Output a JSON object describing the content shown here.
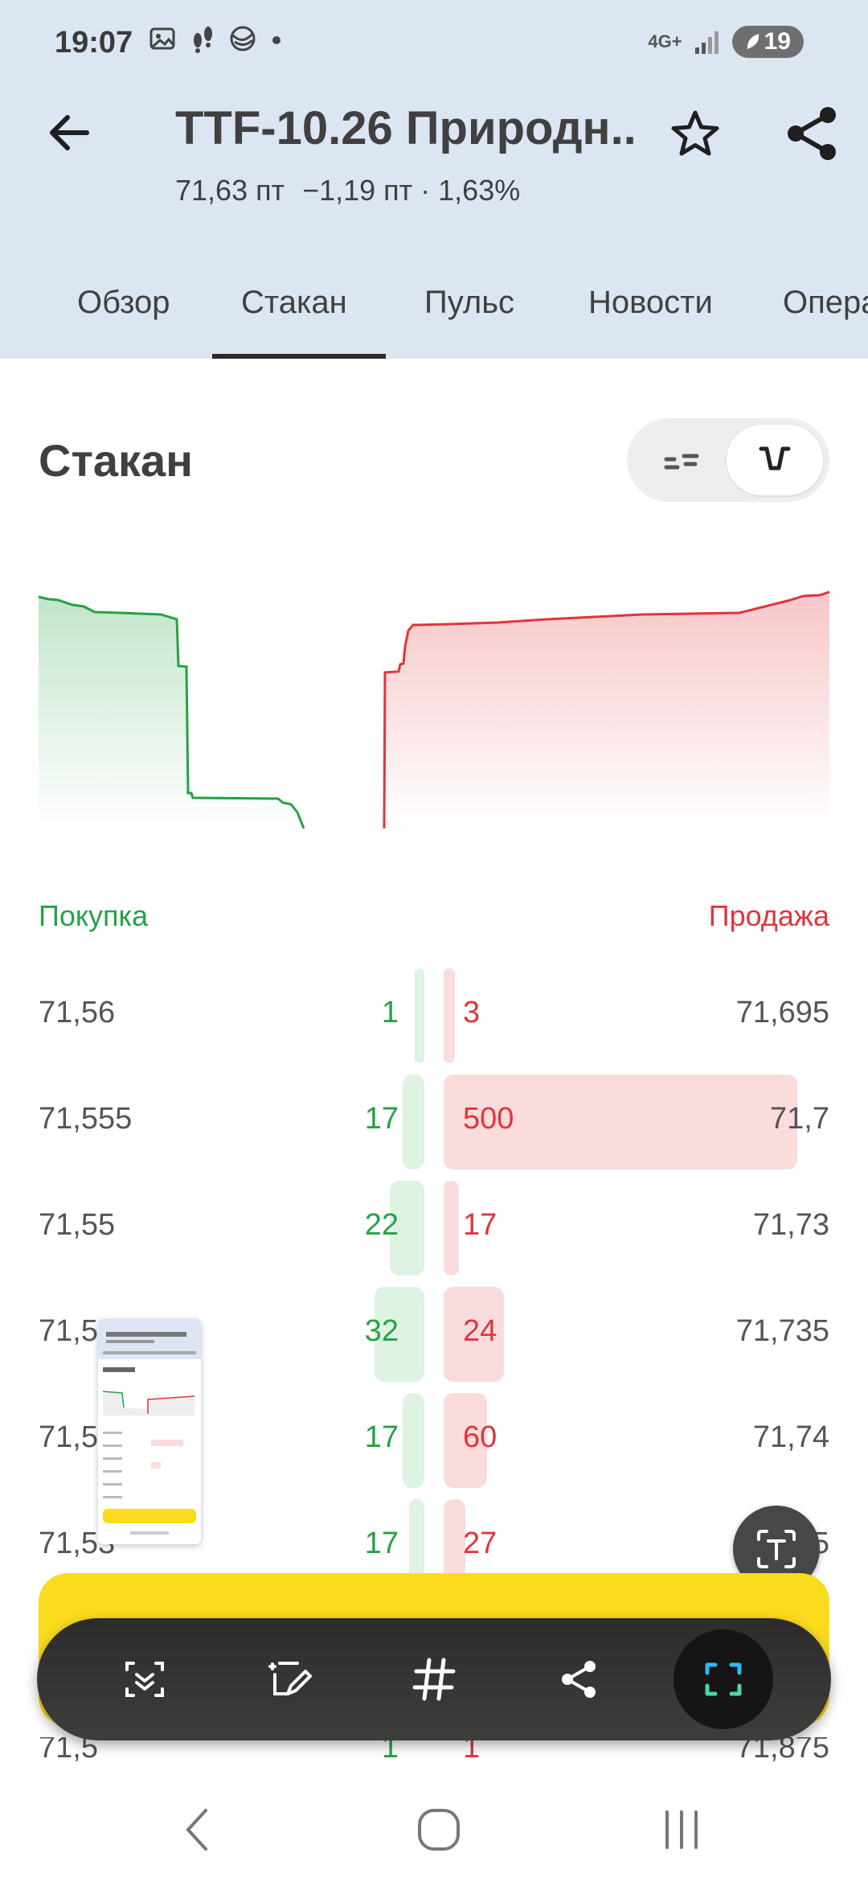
{
  "status": {
    "time": "19:07",
    "network": "4G+",
    "battery": "19",
    "icons_left": [
      "gallery-icon",
      "steps-icon",
      "browser-icon",
      "dot-icon"
    ]
  },
  "header": {
    "title": "TTF-10.26 Природн..",
    "price": "71,63 пт",
    "change": "−1,19 пт · 1,63%"
  },
  "tabs": [
    {
      "label": "Обзор"
    },
    {
      "label": "Стакан",
      "active": true
    },
    {
      "label": "Пульс"
    },
    {
      "label": "Новости"
    },
    {
      "label": "Опера"
    }
  ],
  "section": {
    "title": "Стакан"
  },
  "book": {
    "buy_label": "Покупка",
    "sell_label": "Продажа",
    "rows": [
      {
        "bid_price": "71,56",
        "bid_vol": "1",
        "ask_vol": "3",
        "ask_price": "71,695",
        "bid_level": 0.026,
        "ask_level": 0.032
      },
      {
        "bid_price": "71,555",
        "bid_vol": "17",
        "ask_vol": "500",
        "ask_price": "71,7",
        "bid_level": 0.062,
        "ask_level": 1.0
      },
      {
        "bid_price": "71,55",
        "bid_vol": "22",
        "ask_vol": "17",
        "ask_price": "71,73",
        "bid_level": 0.097,
        "ask_level": 0.044
      },
      {
        "bid_price": "71,5",
        "bid_vol": "32",
        "ask_vol": "24",
        "ask_price": "71,735",
        "bid_level": 0.141,
        "ask_level": 0.171
      },
      {
        "bid_price": "71,5",
        "bid_vol": "17",
        "ask_vol": "60",
        "ask_price": "71,74",
        "bid_level": 0.062,
        "ask_level": 0.123
      },
      {
        "bid_price": "71,53",
        "bid_vol": "17",
        "ask_vol": "27",
        "ask_price": "71,745",
        "bid_level": 0.044,
        "ask_level": 0.062
      }
    ],
    "partial_row": {
      "bid_price": "71,5",
      "bid_vol": "1",
      "ask_vol": "1",
      "ask_price": "71,875"
    }
  },
  "colors": {
    "buy": "#25a244",
    "sell": "#e0353c",
    "accent_yellow": "#fadb1e",
    "header_bg": "#dce6f3"
  },
  "toolbar": {
    "icons": [
      "smart-select-icon",
      "draw-icon",
      "hashtag-icon",
      "share-icon",
      "capture-icon"
    ]
  },
  "nav": {
    "icons": [
      "nav-back-icon",
      "nav-home-icon",
      "nav-recents-icon"
    ]
  }
}
